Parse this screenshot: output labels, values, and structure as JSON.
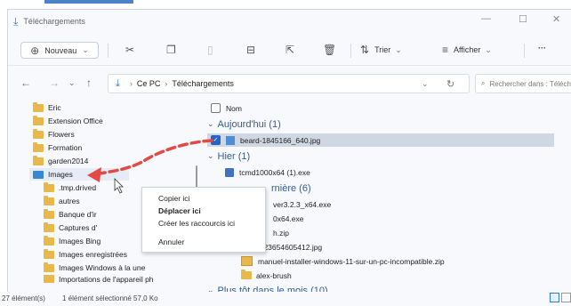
{
  "window": {
    "title": "Téléchargements",
    "minimize_glyph": "—",
    "maximize_glyph": "☐",
    "close_glyph": "✕"
  },
  "toolbar": {
    "new_label": "Nouveau",
    "new_icon": "⊕",
    "sort_label": "Trier",
    "view_label": "Afficher",
    "more_label": "···"
  },
  "address": {
    "crumbs": [
      "Ce PC",
      "Téléchargements"
    ],
    "search_placeholder": "Rechercher dans : Téléchargem..."
  },
  "sidebar": {
    "items": [
      {
        "label": "Eric",
        "icon": "folder"
      },
      {
        "label": "Extension Office",
        "icon": "folder"
      },
      {
        "label": "Flowers",
        "icon": "folder"
      },
      {
        "label": "Formation",
        "icon": "folder"
      },
      {
        "label": "garden2014",
        "icon": "folder"
      },
      {
        "label": "Images",
        "icon": "images"
      },
      {
        "label": ".tmp.drived",
        "icon": "folder"
      },
      {
        "label": "autres",
        "icon": "folder"
      },
      {
        "label": "Banque d'ir",
        "icon": "folder"
      },
      {
        "label": "Captures d'",
        "icon": "folder"
      },
      {
        "label": "Images Bing",
        "icon": "folder"
      },
      {
        "label": "Images enregistrées",
        "icon": "folder"
      },
      {
        "label": "Images Windows à la une",
        "icon": "folder"
      },
      {
        "label": "Importations de l'appareil ph",
        "icon": "folder"
      }
    ]
  },
  "content": {
    "column_name": "Nom",
    "groups": {
      "today": "Aujourd'hui (1)",
      "yesterday": "Hier (1)",
      "last_week": "rnière (6)",
      "earlier": "Plus tôt dans le mois (10)"
    },
    "files": {
      "today_0": "beard-1845166_640.jpg",
      "yesterday_0": "tcmd1000x64 (1).exe",
      "last_0": "ver3.2.3_x64.exe",
      "last_1": "0x64.exe",
      "last_2": "h.zip",
      "last_3": "1623654605412.jpg",
      "last_4": "manuel-installer-windows-11-sur-un-pc-incompatible.zip",
      "last_5": "alex-brush"
    }
  },
  "context_menu": {
    "copy": "Copier ici",
    "move": "Déplacer ici",
    "shortcut": "Créer les raccourcis ici",
    "cancel": "Annuler"
  },
  "status": {
    "count": "27 élément(s)",
    "selection": "1 élément sélectionné  57,0 Ko"
  },
  "colors": {
    "accent": "#2f7ad2",
    "arrow": "#e34a43",
    "folder": "#e8b84b"
  }
}
